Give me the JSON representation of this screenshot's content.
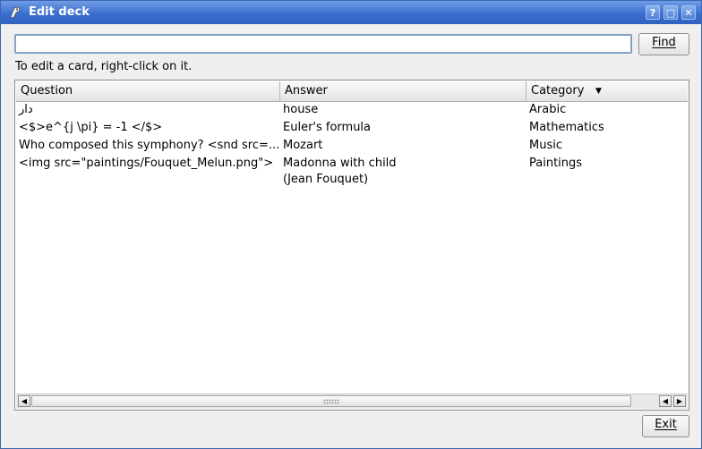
{
  "window": {
    "title": "Edit deck"
  },
  "titlebar": {
    "help": "?",
    "maximize": "□",
    "close": "✕"
  },
  "search": {
    "value": "",
    "placeholder": ""
  },
  "buttons": {
    "find": "Find",
    "exit": "Exit"
  },
  "hint": "To edit a card, right-click on it.",
  "table": {
    "columns": [
      "Question",
      "Answer",
      "Category"
    ],
    "sort_column": "Category",
    "rows": [
      {
        "question": "دار",
        "answer": "house",
        "category": "Arabic"
      },
      {
        "question": "<$>e^{j \\pi} = -1 </$>",
        "answer": "Euler's formula",
        "category": "Mathematics"
      },
      {
        "question": "Who composed this symphony? <snd src=...",
        "answer": "Mozart",
        "category": "Music"
      },
      {
        "question": "<img src=\"paintings/Fouquet_Melun.png\">",
        "answer": "Madonna with child\n(Jean Fouquet)",
        "category": "Paintings"
      }
    ]
  },
  "icons": [
    "app-icon",
    "help-icon",
    "maximize-icon",
    "close-icon",
    "sort-down-icon",
    "scroll-left-icon",
    "scroll-right-icon"
  ]
}
